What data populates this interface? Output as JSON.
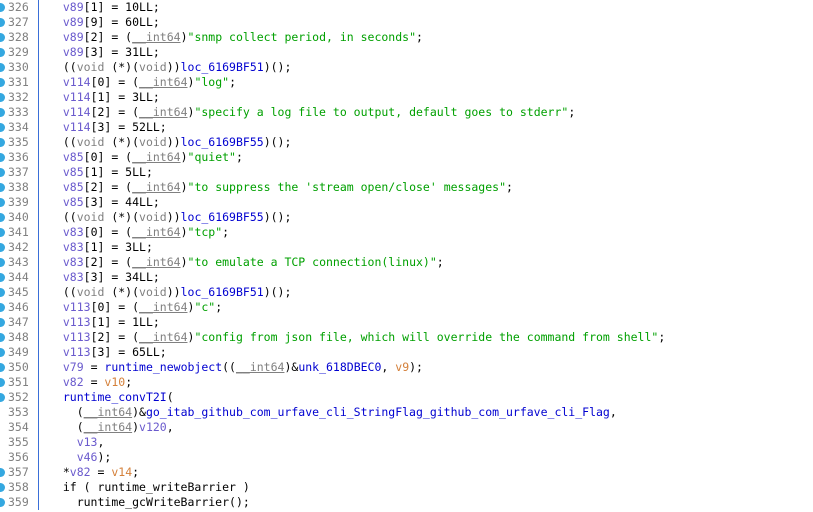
{
  "view": {
    "name": "ida-pseudocode-view",
    "kind": "decompiler-pseudocode",
    "background_color": "#ffffff",
    "gutter_rule_color": "#3a6fd8",
    "marker_color": "#35a8e0",
    "first_line_number": 326,
    "last_line_number": 359
  },
  "colors": {
    "local_variable": "#6a5acd",
    "register_variable": "#d4803a",
    "string_literal": "#00a000",
    "type_keyword": "#808080",
    "address_name": "#0000d0",
    "function_name": "#0000d0",
    "line_number": "#808080",
    "plain_text": "#000000"
  },
  "lines": [
    {
      "number": "326",
      "marker": true,
      "tokens": [
        {
          "t": "  ",
          "c": "plain"
        },
        {
          "t": "v89",
          "c": "lvar"
        },
        {
          "t": "[1] = 10LL;",
          "c": "plain"
        }
      ]
    },
    {
      "number": "327",
      "marker": true,
      "tokens": [
        {
          "t": "  ",
          "c": "plain"
        },
        {
          "t": "v89",
          "c": "lvar"
        },
        {
          "t": "[9] = 60LL;",
          "c": "plain"
        }
      ]
    },
    {
      "number": "328",
      "marker": true,
      "tokens": [
        {
          "t": "  ",
          "c": "plain"
        },
        {
          "t": "v89",
          "c": "lvar"
        },
        {
          "t": "[2] = (",
          "c": "plain"
        },
        {
          "t": "__int64",
          "c": "type"
        },
        {
          "t": ")",
          "c": "plain"
        },
        {
          "t": "\"snmp collect period, in seconds\"",
          "c": "string"
        },
        {
          "t": ";",
          "c": "plain"
        }
      ]
    },
    {
      "number": "329",
      "marker": true,
      "tokens": [
        {
          "t": "  ",
          "c": "plain"
        },
        {
          "t": "v89",
          "c": "lvar"
        },
        {
          "t": "[3] = 31LL;",
          "c": "plain"
        }
      ]
    },
    {
      "number": "330",
      "marker": true,
      "tokens": [
        {
          "t": "  ((",
          "c": "plain"
        },
        {
          "t": "void",
          "c": "keyword"
        },
        {
          "t": " (*)(",
          "c": "plain"
        },
        {
          "t": "void",
          "c": "keyword"
        },
        {
          "t": "))",
          "c": "plain"
        },
        {
          "t": "loc_6169BF51",
          "c": "loc"
        },
        {
          "t": ")();",
          "c": "plain"
        }
      ]
    },
    {
      "number": "331",
      "marker": true,
      "tokens": [
        {
          "t": "  ",
          "c": "plain"
        },
        {
          "t": "v114",
          "c": "lvar"
        },
        {
          "t": "[0] = (",
          "c": "plain"
        },
        {
          "t": "__int64",
          "c": "type"
        },
        {
          "t": ")",
          "c": "plain"
        },
        {
          "t": "\"log\"",
          "c": "string"
        },
        {
          "t": ";",
          "c": "plain"
        }
      ]
    },
    {
      "number": "332",
      "marker": true,
      "tokens": [
        {
          "t": "  ",
          "c": "plain"
        },
        {
          "t": "v114",
          "c": "lvar"
        },
        {
          "t": "[1] = 3LL;",
          "c": "plain"
        }
      ]
    },
    {
      "number": "333",
      "marker": true,
      "tokens": [
        {
          "t": "  ",
          "c": "plain"
        },
        {
          "t": "v114",
          "c": "lvar"
        },
        {
          "t": "[2] = (",
          "c": "plain"
        },
        {
          "t": "__int64",
          "c": "type"
        },
        {
          "t": ")",
          "c": "plain"
        },
        {
          "t": "\"specify a log file to output, default goes to stderr\"",
          "c": "string"
        },
        {
          "t": ";",
          "c": "plain"
        }
      ]
    },
    {
      "number": "334",
      "marker": true,
      "tokens": [
        {
          "t": "  ",
          "c": "plain"
        },
        {
          "t": "v114",
          "c": "lvar"
        },
        {
          "t": "[3] = 52LL;",
          "c": "plain"
        }
      ]
    },
    {
      "number": "335",
      "marker": true,
      "tokens": [
        {
          "t": "  ((",
          "c": "plain"
        },
        {
          "t": "void",
          "c": "keyword"
        },
        {
          "t": " (*)(",
          "c": "plain"
        },
        {
          "t": "void",
          "c": "keyword"
        },
        {
          "t": "))",
          "c": "plain"
        },
        {
          "t": "loc_6169BF55",
          "c": "loc"
        },
        {
          "t": ")();",
          "c": "plain"
        }
      ]
    },
    {
      "number": "336",
      "marker": true,
      "tokens": [
        {
          "t": "  ",
          "c": "plain"
        },
        {
          "t": "v85",
          "c": "lvar"
        },
        {
          "t": "[0] = (",
          "c": "plain"
        },
        {
          "t": "__int64",
          "c": "type"
        },
        {
          "t": ")",
          "c": "plain"
        },
        {
          "t": "\"quiet\"",
          "c": "string"
        },
        {
          "t": ";",
          "c": "plain"
        }
      ]
    },
    {
      "number": "337",
      "marker": true,
      "tokens": [
        {
          "t": "  ",
          "c": "plain"
        },
        {
          "t": "v85",
          "c": "lvar"
        },
        {
          "t": "[1] = 5LL;",
          "c": "plain"
        }
      ]
    },
    {
      "number": "338",
      "marker": true,
      "tokens": [
        {
          "t": "  ",
          "c": "plain"
        },
        {
          "t": "v85",
          "c": "lvar"
        },
        {
          "t": "[2] = (",
          "c": "plain"
        },
        {
          "t": "__int64",
          "c": "type"
        },
        {
          "t": ")",
          "c": "plain"
        },
        {
          "t": "\"to suppress the 'stream open/close' messages\"",
          "c": "string"
        },
        {
          "t": ";",
          "c": "plain"
        }
      ]
    },
    {
      "number": "339",
      "marker": true,
      "tokens": [
        {
          "t": "  ",
          "c": "plain"
        },
        {
          "t": "v85",
          "c": "lvar"
        },
        {
          "t": "[3] = 44LL;",
          "c": "plain"
        }
      ]
    },
    {
      "number": "340",
      "marker": true,
      "tokens": [
        {
          "t": "  ((",
          "c": "plain"
        },
        {
          "t": "void",
          "c": "keyword"
        },
        {
          "t": " (*)(",
          "c": "plain"
        },
        {
          "t": "void",
          "c": "keyword"
        },
        {
          "t": "))",
          "c": "plain"
        },
        {
          "t": "loc_6169BF55",
          "c": "loc"
        },
        {
          "t": ")();",
          "c": "plain"
        }
      ]
    },
    {
      "number": "341",
      "marker": true,
      "tokens": [
        {
          "t": "  ",
          "c": "plain"
        },
        {
          "t": "v83",
          "c": "lvar"
        },
        {
          "t": "[0] = (",
          "c": "plain"
        },
        {
          "t": "__int64",
          "c": "type"
        },
        {
          "t": ")",
          "c": "plain"
        },
        {
          "t": "\"tcp\"",
          "c": "string"
        },
        {
          "t": ";",
          "c": "plain"
        }
      ]
    },
    {
      "number": "342",
      "marker": true,
      "tokens": [
        {
          "t": "  ",
          "c": "plain"
        },
        {
          "t": "v83",
          "c": "lvar"
        },
        {
          "t": "[1] = 3LL;",
          "c": "plain"
        }
      ]
    },
    {
      "number": "343",
      "marker": true,
      "tokens": [
        {
          "t": "  ",
          "c": "plain"
        },
        {
          "t": "v83",
          "c": "lvar"
        },
        {
          "t": "[2] = (",
          "c": "plain"
        },
        {
          "t": "__int64",
          "c": "type"
        },
        {
          "t": ")",
          "c": "plain"
        },
        {
          "t": "\"to emulate a TCP connection(linux)\"",
          "c": "string"
        },
        {
          "t": ";",
          "c": "plain"
        }
      ]
    },
    {
      "number": "344",
      "marker": true,
      "tokens": [
        {
          "t": "  ",
          "c": "plain"
        },
        {
          "t": "v83",
          "c": "lvar"
        },
        {
          "t": "[3] = 34LL;",
          "c": "plain"
        }
      ]
    },
    {
      "number": "345",
      "marker": true,
      "tokens": [
        {
          "t": "  ((",
          "c": "plain"
        },
        {
          "t": "void",
          "c": "keyword"
        },
        {
          "t": " (*)(",
          "c": "plain"
        },
        {
          "t": "void",
          "c": "keyword"
        },
        {
          "t": "))",
          "c": "plain"
        },
        {
          "t": "loc_6169BF51",
          "c": "loc"
        },
        {
          "t": ")();",
          "c": "plain"
        }
      ]
    },
    {
      "number": "346",
      "marker": true,
      "tokens": [
        {
          "t": "  ",
          "c": "plain"
        },
        {
          "t": "v113",
          "c": "lvar"
        },
        {
          "t": "[0] = (",
          "c": "plain"
        },
        {
          "t": "__int64",
          "c": "type"
        },
        {
          "t": ")",
          "c": "plain"
        },
        {
          "t": "\"c\"",
          "c": "string"
        },
        {
          "t": ";",
          "c": "plain"
        }
      ]
    },
    {
      "number": "347",
      "marker": true,
      "tokens": [
        {
          "t": "  ",
          "c": "plain"
        },
        {
          "t": "v113",
          "c": "lvar"
        },
        {
          "t": "[1] = 1LL;",
          "c": "plain"
        }
      ]
    },
    {
      "number": "348",
      "marker": true,
      "tokens": [
        {
          "t": "  ",
          "c": "plain"
        },
        {
          "t": "v113",
          "c": "lvar"
        },
        {
          "t": "[2] = (",
          "c": "plain"
        },
        {
          "t": "__int64",
          "c": "type"
        },
        {
          "t": ")",
          "c": "plain"
        },
        {
          "t": "\"config from json file, which will override the command from shell\"",
          "c": "string"
        },
        {
          "t": ";",
          "c": "plain"
        }
      ]
    },
    {
      "number": "349",
      "marker": true,
      "tokens": [
        {
          "t": "  ",
          "c": "plain"
        },
        {
          "t": "v113",
          "c": "lvar"
        },
        {
          "t": "[3] = 65LL;",
          "c": "plain"
        }
      ]
    },
    {
      "number": "350",
      "marker": true,
      "tokens": [
        {
          "t": "  ",
          "c": "plain"
        },
        {
          "t": "v79",
          "c": "lvar"
        },
        {
          "t": " = ",
          "c": "plain"
        },
        {
          "t": "runtime_newobject",
          "c": "func"
        },
        {
          "t": "((",
          "c": "plain"
        },
        {
          "t": "__int64",
          "c": "type"
        },
        {
          "t": ")&",
          "c": "plain"
        },
        {
          "t": "unk_618DBEC0",
          "c": "loc"
        },
        {
          "t": ", ",
          "c": "plain"
        },
        {
          "t": "v9",
          "c": "reg"
        },
        {
          "t": ");",
          "c": "plain"
        }
      ]
    },
    {
      "number": "351",
      "marker": true,
      "tokens": [
        {
          "t": "  ",
          "c": "plain"
        },
        {
          "t": "v82",
          "c": "lvar"
        },
        {
          "t": " = ",
          "c": "plain"
        },
        {
          "t": "v10",
          "c": "reg"
        },
        {
          "t": ";",
          "c": "plain"
        }
      ]
    },
    {
      "number": "352",
      "marker": true,
      "tokens": [
        {
          "t": "  ",
          "c": "plain"
        },
        {
          "t": "runtime_convT2I",
          "c": "func"
        },
        {
          "t": "(",
          "c": "plain"
        }
      ]
    },
    {
      "number": "353",
      "marker": false,
      "tokens": [
        {
          "t": "    (",
          "c": "plain"
        },
        {
          "t": "__int64",
          "c": "type"
        },
        {
          "t": ")&",
          "c": "plain"
        },
        {
          "t": "go_itab_github_com_urfave_cli_StringFlag_github_com_urfave_cli_Flag",
          "c": "loc"
        },
        {
          "t": ",",
          "c": "plain"
        }
      ]
    },
    {
      "number": "354",
      "marker": false,
      "tokens": [
        {
          "t": "    (",
          "c": "plain"
        },
        {
          "t": "__int64",
          "c": "type"
        },
        {
          "t": ")",
          "c": "plain"
        },
        {
          "t": "v120",
          "c": "lvar"
        },
        {
          "t": ",",
          "c": "plain"
        }
      ]
    },
    {
      "number": "355",
      "marker": false,
      "tokens": [
        {
          "t": "    ",
          "c": "plain"
        },
        {
          "t": "v13",
          "c": "lvar"
        },
        {
          "t": ",",
          "c": "plain"
        }
      ]
    },
    {
      "number": "356",
      "marker": false,
      "tokens": [
        {
          "t": "    ",
          "c": "plain"
        },
        {
          "t": "v46",
          "c": "lvar"
        },
        {
          "t": ");",
          "c": "plain"
        }
      ]
    },
    {
      "number": "357",
      "marker": true,
      "tokens": [
        {
          "t": "  *",
          "c": "plain"
        },
        {
          "t": "v82",
          "c": "lvar"
        },
        {
          "t": " = ",
          "c": "plain"
        },
        {
          "t": "v14",
          "c": "reg"
        },
        {
          "t": ";",
          "c": "plain"
        }
      ]
    },
    {
      "number": "358",
      "marker": true,
      "tokens": [
        {
          "t": "  if ( ",
          "c": "plain"
        },
        {
          "t": "runtime_writeBarrier",
          "c": "plain"
        },
        {
          "t": " )",
          "c": "plain"
        }
      ]
    },
    {
      "number": "359",
      "marker": true,
      "tokens": [
        {
          "t": "    ",
          "c": "plain"
        },
        {
          "t": "runtime_gcWriteBarrier",
          "c": "plain"
        },
        {
          "t": "();",
          "c": "plain"
        }
      ]
    }
  ]
}
